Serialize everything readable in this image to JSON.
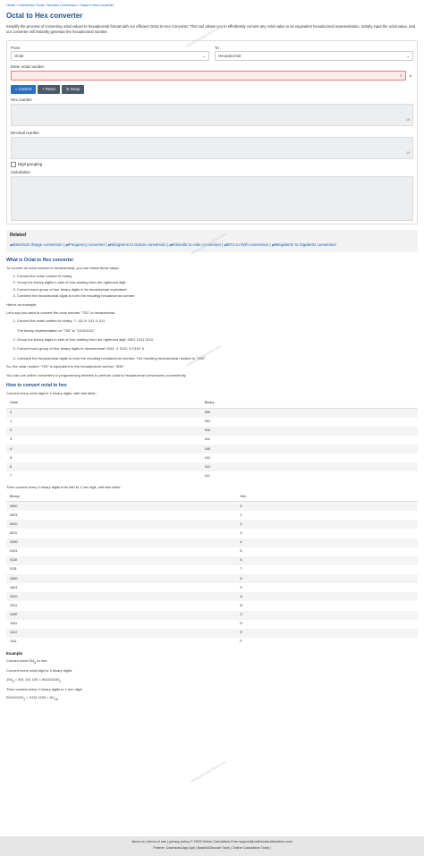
{
  "breadcrumb": [
    "Home",
    "Conversion Tools",
    "Number Conversion",
    "Octal to Hex converter"
  ],
  "title": "Octal to Hex converter",
  "intro": "Simplify the process of converting octal values to hexadecimal format with our efficient Octal to Hex Converter. This tool allows you to effortlessly convert any octal value to its equivalent hexadecimal representation. Simply input the octal value, and our converter will instantly generate the hexadecimal number.",
  "form": {
    "from_label": "From",
    "from_value": "Octal",
    "to_label": "To",
    "to_value": "Hexadecimal",
    "enter_label": "Enter octal number",
    "sub": "8",
    "convert": "= Convert",
    "reset": "× Reset",
    "swap": "⇅ Swap",
    "hex_label": "Hex number",
    "hex_base": "16",
    "dec_label": "Decimal number",
    "dec_base": "10",
    "digit_grouping": "Digit grouping",
    "calc_label": "Calculation"
  },
  "related": {
    "title": "Related",
    "links": [
      "Electrical charge conversion",
      "Frequency converter",
      "Kilograms to Grams conversion",
      "Kilovolts to volts conversion",
      "BTU to kWh conversion",
      "Megahertz to Gigahertz conversion"
    ]
  },
  "what": {
    "title": "What is Octal to Hex converter",
    "p1": "To convert an octal number to hexadecimal, you can follow these steps:",
    "steps": [
      "Convert the octal number to binary.",
      "Group the binary digits in sets of four starting from the rightmost digit.",
      "Convert each group of four binary digits to its hexadecimal equivalent.",
      "Combine the hexadecimal digits to form the resulting hexadecimal number."
    ],
    "p2": "Here's an example:",
    "p3": "Let's say you want to convert the octal number \"753\" to hexadecimal.",
    "ex1": "Convert the octal number to binary: 7: 111 5: 101 3: 011",
    "ex1b": "The binary representation of \"753\" is \"111101011\".",
    "ex2": "Group the binary digits in sets of four starting from the rightmost digit: 0001 1101 0110",
    "ex3": "Convert each group of four binary digits to hexadecimal: 0011: 3 1101: D 0110: 6",
    "ex4": "Combine the hexadecimal digits to form the resulting hexadecimal number: The resulting hexadecimal number is \"3D6\".",
    "p4": "So, the octal number \"753\" is equivalent to the hexadecimal number \"3D6\".",
    "p5": "You can use online converters or programming libraries to perform octal to hexadecimal conversions conveniently."
  },
  "how": {
    "title": "How to convert octal to hex",
    "p1": "Convert every octal digit to 3 binary digits, with this table:",
    "t1_head": [
      "Octal",
      "Binary"
    ],
    "t1": [
      [
        "0",
        "000"
      ],
      [
        "1",
        "001"
      ],
      [
        "2",
        "010"
      ],
      [
        "3",
        "011"
      ],
      [
        "4",
        "100"
      ],
      [
        "5",
        "101"
      ],
      [
        "6",
        "110"
      ],
      [
        "7",
        "111"
      ]
    ],
    "p2": "Then convert every 4 binary digits from bit0 to 1 hex digit, with this table:",
    "t2_head": [
      "Binary",
      "Hex"
    ],
    "t2": [
      [
        "0000",
        "0"
      ],
      [
        "0001",
        "1"
      ],
      [
        "0010",
        "2"
      ],
      [
        "0011",
        "3"
      ],
      [
        "0100",
        "4"
      ],
      [
        "0101",
        "5"
      ],
      [
        "0110",
        "6"
      ],
      [
        "0111",
        "7"
      ],
      [
        "1000",
        "8"
      ],
      [
        "1001",
        "9"
      ],
      [
        "1010",
        "A"
      ],
      [
        "1011",
        "B"
      ],
      [
        "1100",
        "C"
      ],
      [
        "1101",
        "D"
      ],
      [
        "1110",
        "E"
      ],
      [
        "1111",
        "F"
      ]
    ]
  },
  "example": {
    "title": "Example",
    "l1": "Convert octal 154",
    "l1sub": "8",
    "l1end": " to hex:",
    "l2": "Convert every octal digit to 3 binary digits:",
    "l3": "154",
    "l3sub": "8",
    "l3b": " = 001 101 100 = 001101100",
    "l3bsub": "2",
    "l4": "Then convert every 4 binary digits to 1 hex digit:",
    "l5": "001101100",
    "l5sub": "2",
    "l5b": " = 0110 1100 = 6C",
    "l5bsub": "16"
  },
  "footer": {
    "line1": "about us | terms of use | privacy policy  © 2023 Online Calculators Free   support@onlinecalculatorsfree.com",
    "line2": "Partner:   Download App Apk | Base64Decode Tools | Online Calculators Tools |"
  },
  "watermark": "onlinecalculatorsfree.com"
}
